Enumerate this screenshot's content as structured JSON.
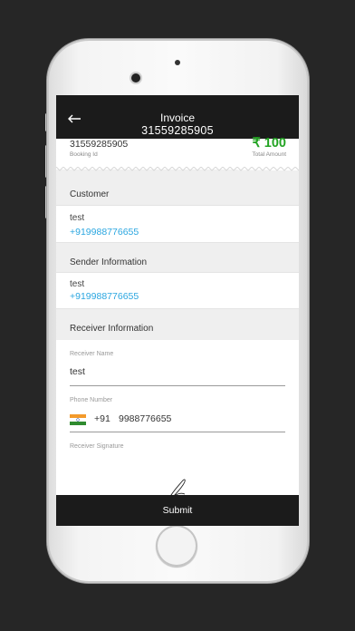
{
  "header": {
    "title": "Invoice",
    "invoice_number": "31559285905"
  },
  "summary": {
    "booking_id": "31559285905",
    "booking_id_label": "Booking Id",
    "total_amount": "₹ 100",
    "total_amount_label": "Total Amount"
  },
  "customer": {
    "heading": "Customer",
    "name": "test",
    "phone": "+919988776655"
  },
  "sender": {
    "heading": "Sender Information",
    "name": "test",
    "phone": "+919988776655"
  },
  "receiver": {
    "heading": "Receiver Information",
    "name_label": "Receiver Name",
    "name_value": "test",
    "phone_label": "Phone Number",
    "country_code": "+91",
    "phone_value": "9988776655",
    "signature_label": "Receiver Signature"
  },
  "submit_label": "Submit",
  "colors": {
    "amount": "#22a322",
    "link": "#2aa6e0",
    "bar": "#1b1b1b"
  }
}
